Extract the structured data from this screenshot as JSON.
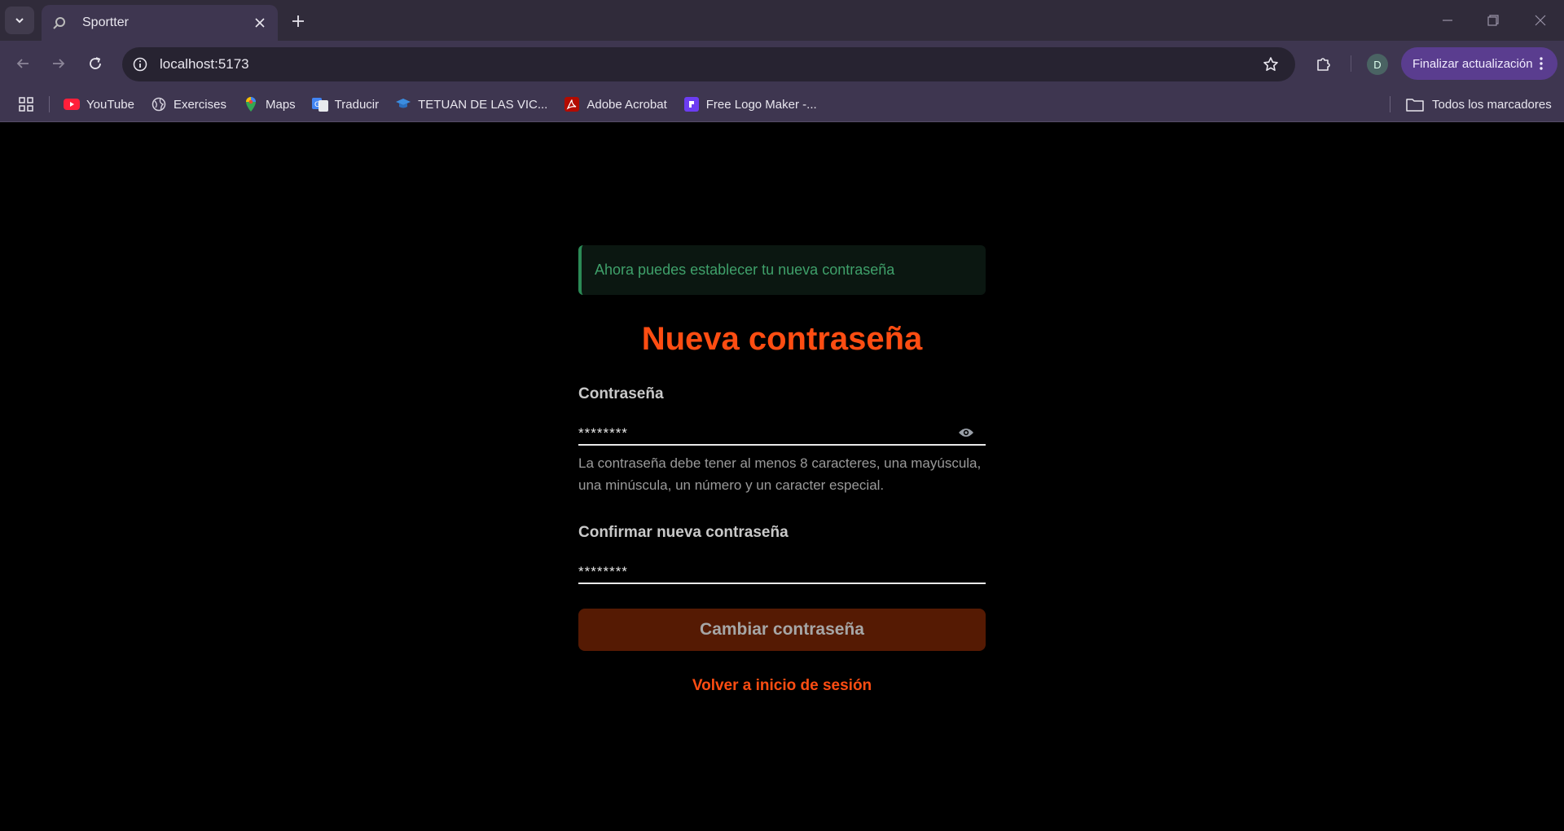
{
  "browser": {
    "tab": {
      "title": "Sportter"
    },
    "address": {
      "url": "localhost:5173"
    },
    "profile_initial": "D",
    "update_label": "Finalizar actualización",
    "bookmarks": [
      {
        "label": "YouTube",
        "icon": "youtube-icon"
      },
      {
        "label": "Exercises",
        "icon": "globe-icon"
      },
      {
        "label": "Maps",
        "icon": "maps-pin-icon"
      },
      {
        "label": "Traducir",
        "icon": "translate-icon"
      },
      {
        "label": "TETUAN DE LAS VIC...",
        "icon": "graduation-cap-icon"
      },
      {
        "label": "Adobe Acrobat",
        "icon": "acrobat-icon"
      },
      {
        "label": "Free Logo Maker -...",
        "icon": "logo-maker-icon"
      }
    ],
    "all_bookmarks": "Todos los marcadores"
  },
  "page": {
    "alert": "Ahora puedes establecer tu nueva contraseña",
    "title": "Nueva contraseña",
    "password": {
      "label": "Contraseña",
      "value": "********",
      "hint": "La contraseña debe tener al menos 8 caracteres, una mayúscula, una minúscula, un número y un caracter especial."
    },
    "confirm": {
      "label": "Confirmar nueva contraseña",
      "value": "********"
    },
    "submit_label": "Cambiar contraseña",
    "back_link": "Volver a inicio de sesión"
  },
  "colors": {
    "accent": "#ff4d12",
    "alert_text": "#3fa06a",
    "button_bg": "#551a03",
    "chrome_bg": "#3e3650"
  }
}
